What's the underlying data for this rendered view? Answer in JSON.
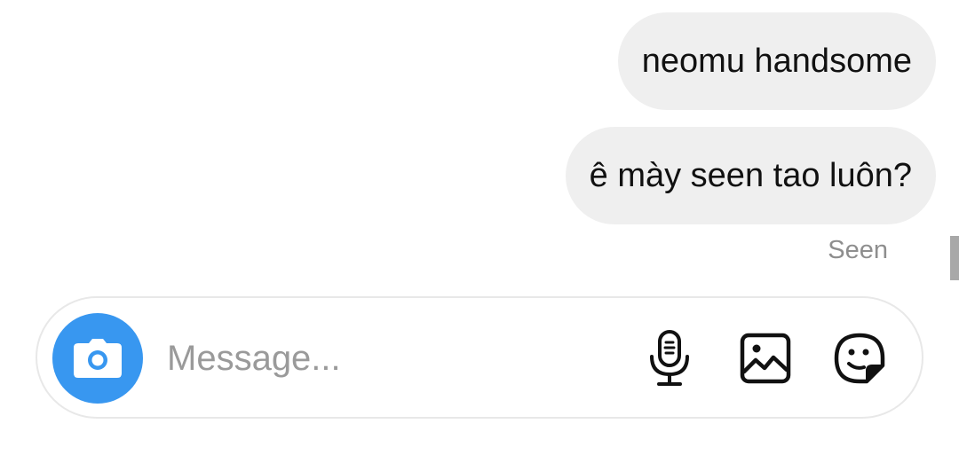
{
  "thread": {
    "messages": [
      {
        "text": "neomu handsome"
      },
      {
        "text": "ê mày seen tao luôn?"
      }
    ],
    "status": "Seen"
  },
  "composer": {
    "placeholder": "Message...",
    "value": "",
    "icons": {
      "camera": "camera-icon",
      "mic": "microphone-icon",
      "gallery": "image-icon",
      "sticker": "sticker-icon"
    }
  },
  "colors": {
    "bubble_bg": "#efefef",
    "camera_bg": "#3897f0",
    "seen_text": "#8e8e8e",
    "composer_border": "#e8e8e8"
  }
}
